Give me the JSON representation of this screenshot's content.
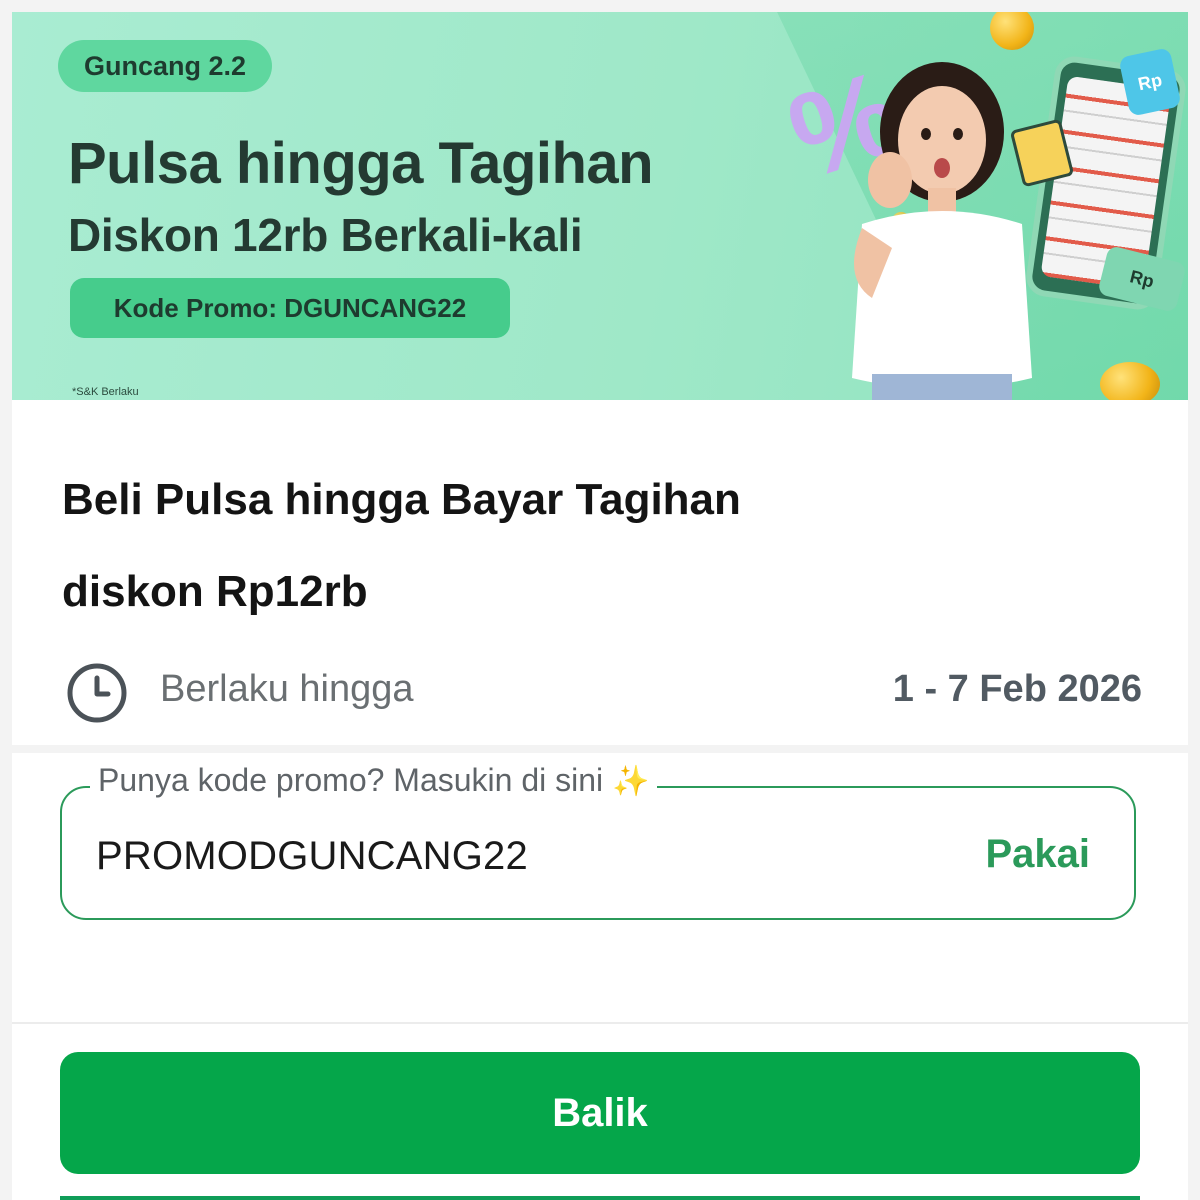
{
  "banner": {
    "tag": "Guncang 2.2",
    "headline_line1": "Pulsa hingga Tagihan",
    "headline_line2": "Diskon 12rb Berkali-kali",
    "promo_code_label": "Kode Promo: DGUNCANG22",
    "terms": "*S&K Berlaku",
    "rp_tag_1": "Rp",
    "rp_tag_2": "Rp"
  },
  "promo": {
    "title_line1": "Beli Pulsa hingga Bayar Tagihan",
    "title_line2": "diskon Rp12rb",
    "validity_label": "Berlaku hingga",
    "validity_date": "1 - 7 Feb 2026"
  },
  "promo_input": {
    "label": "Punya kode promo? Masukin di sini",
    "label_emoji": "✨",
    "value": "PROMODGUNCANG22",
    "apply_label": "Pakai"
  },
  "footer": {
    "back_label": "Balik"
  },
  "colors": {
    "primary_green": "#05a64a",
    "accent_green": "#2b9a5a",
    "banner_bg": "#a9ecd2"
  },
  "icons": {
    "validity": "clock-icon",
    "label_decoration": "sparkles-icon"
  }
}
